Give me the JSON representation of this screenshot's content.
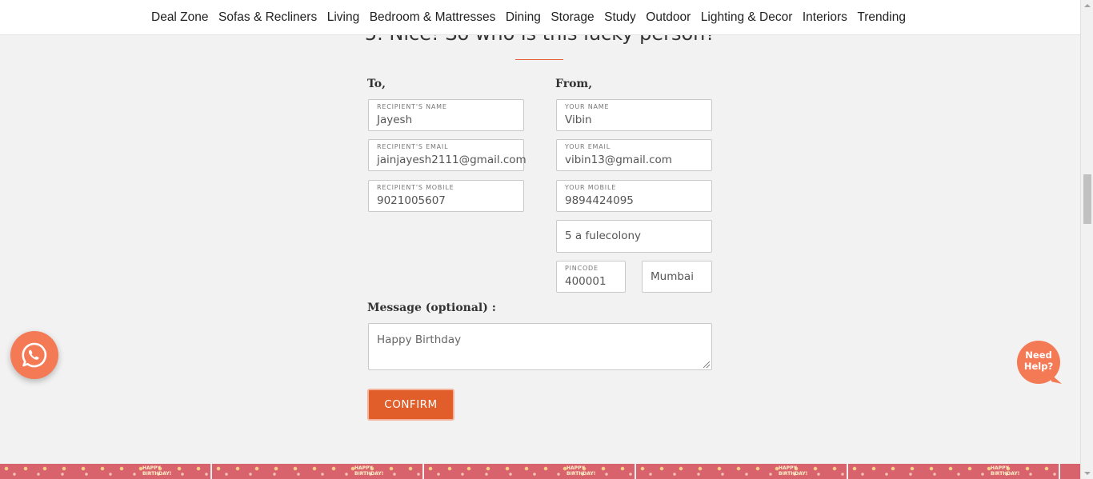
{
  "nav": {
    "items": [
      "Deal Zone",
      "Sofas & Recliners",
      "Living",
      "Bedroom & Mattresses",
      "Dining",
      "Storage",
      "Study",
      "Outdoor",
      "Lighting & Decor",
      "Interiors",
      "Trending"
    ]
  },
  "heading": "5. Nice! So who is this lucky person?",
  "to": {
    "label": "To,",
    "name_label": "Recipient's Name",
    "name_value": "Jayesh",
    "email_label": "Recipient's Email",
    "email_value": "jainjayesh2111@gmail.com",
    "mobile_label": "Recipient's Mobile",
    "mobile_value": "9021005607"
  },
  "from": {
    "label": "From,",
    "name_label": "Your Name",
    "name_value": "Vibin",
    "email_label": "Your Email",
    "email_value": "vibin13@gmail.com",
    "mobile_label": "Your Mobile",
    "mobile_value": "9894424095",
    "address_value": "5 a fulecolony",
    "pincode_label": "Pincode",
    "pincode_value": "400001",
    "city_value": "Mumbai"
  },
  "message": {
    "label": "Message (optional) :",
    "value": "Happy Birthday"
  },
  "confirm_label": "CONFIRM",
  "need_help_text": "Need Help?",
  "banner_text": "HAPPY BIRTHDAY!",
  "colors": {
    "accent": "#e15e2a",
    "float_button": "#f47a55",
    "banner": "#d9636d"
  },
  "icons": {
    "whatsapp": "whatsapp-icon",
    "chat": "chat-bubble-icon"
  }
}
